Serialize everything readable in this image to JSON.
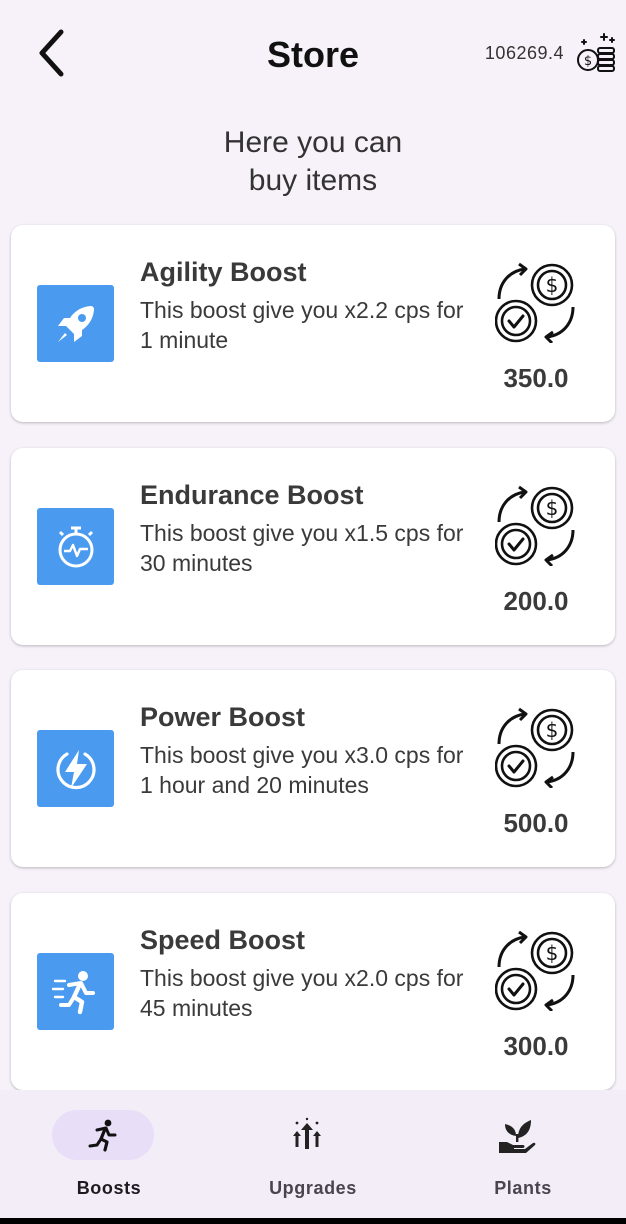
{
  "header": {
    "title": "Store",
    "balance": "106269.4"
  },
  "subtitle": {
    "line1": "Here you can",
    "line2": "buy items"
  },
  "items": [
    {
      "name": "Agility Boost",
      "description": "This boost give you x2.2 cps for 1 minute",
      "price": "350.0",
      "icon": "rocket-icon"
    },
    {
      "name": "Endurance Boost",
      "description": "This boost give you x1.5 cps for 30 minutes",
      "price": "200.0",
      "icon": "stopwatch-icon"
    },
    {
      "name": "Power Boost",
      "description": "This boost give you x3.0 cps for 1 hour and 20 minutes",
      "price": "500.0",
      "icon": "lightning-icon"
    },
    {
      "name": "Speed Boost",
      "description": "This boost give you x2.0 cps for 45 minutes",
      "price": "300.0",
      "icon": "running-person-icon"
    }
  ],
  "nav": {
    "tabs": [
      {
        "label": "Boosts",
        "icon": "running-icon",
        "active": true
      },
      {
        "label": "Upgrades",
        "icon": "upgrade-arrows-icon",
        "active": false
      },
      {
        "label": "Plants",
        "icon": "plant-hand-icon",
        "active": false
      }
    ]
  },
  "colors": {
    "accent": "#4a9bf0",
    "background": "#f7f2fa",
    "nav_background": "#f3edf7",
    "active_pill": "#e8def8"
  }
}
